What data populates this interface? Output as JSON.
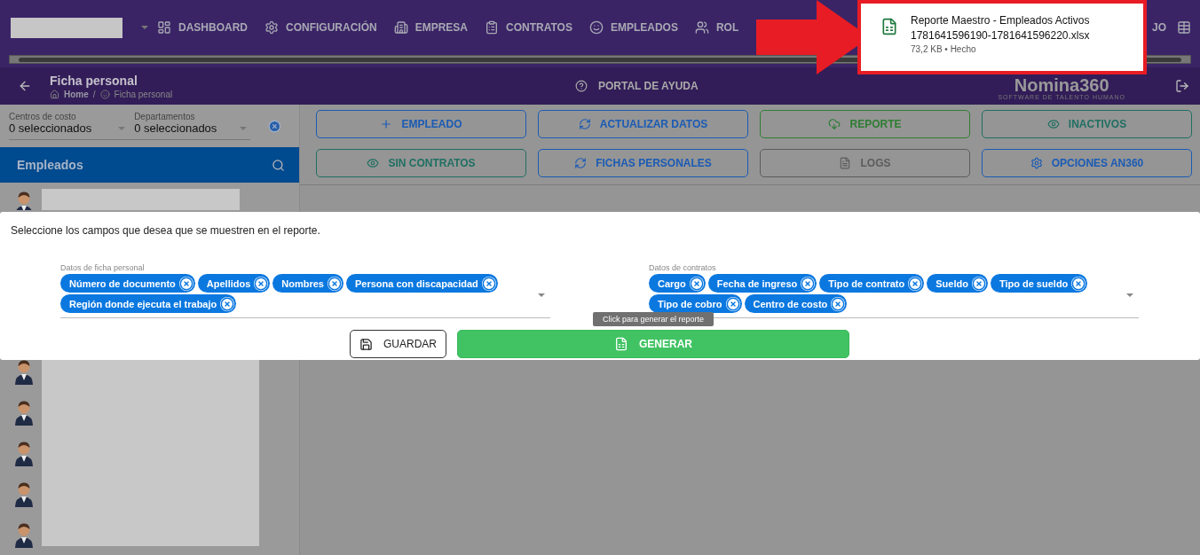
{
  "nav": {
    "items": [
      {
        "label": "DASHBOARD"
      },
      {
        "label": "CONFIGURACIÓN"
      },
      {
        "label": "EMPRESA"
      },
      {
        "label": "CONTRATOS"
      },
      {
        "label": "EMPLEADOS"
      },
      {
        "label": "ROL"
      }
    ],
    "trailing": {
      "label": "JO"
    }
  },
  "header": {
    "title": "Ficha personal",
    "breadcrumb": [
      "Home",
      "Ficha personal"
    ],
    "separator": "/",
    "help": "PORTAL DE AYUDA",
    "logo": "Nomina360",
    "tagline": "SOFTWARE DE TALENTO HUMANO"
  },
  "filters": [
    {
      "label": "Centros de costo",
      "value": "0 seleccionados"
    },
    {
      "label": "Departamentos",
      "value": "0 seleccionados"
    }
  ],
  "employees_panel": {
    "title": "Empleados"
  },
  "actions": [
    {
      "label": "EMPLEADO",
      "color": "#1a5bb5"
    },
    {
      "label": "ACTUALIZAR DATOS",
      "color": "#1a5bb5"
    },
    {
      "label": "REPORTE",
      "color": "#2e7d32"
    },
    {
      "label": "INACTIVOS",
      "color": "#1f6f62"
    },
    {
      "label": "SIN CONTRATOS",
      "color": "#1f6f62"
    },
    {
      "label": "FICHAS PERSONALES",
      "color": "#1a5bb5"
    },
    {
      "label": "LOGS",
      "color": "#5c5c5c"
    },
    {
      "label": "OPCIONES AN360",
      "color": "#1a5bb5"
    }
  ],
  "dialog": {
    "prompt": "Seleccione los campos que desea que se muestren en el reporte.",
    "selects": [
      {
        "label": "Datos de ficha personal",
        "chips": [
          "Número de documento",
          "Apellidos",
          "Nombres",
          "Persona con discapacidad",
          "Región donde ejecuta el trabajo"
        ]
      },
      {
        "label": "Datos de contratos",
        "chips": [
          "Cargo",
          "Fecha de ingreso",
          "Tipo de contrato",
          "Sueldo",
          "Tipo de sueldo",
          "Tipo de cobro",
          "Centro de costo"
        ]
      }
    ],
    "buttons": [
      {
        "label": "GUARDAR",
        "kind": "outline"
      },
      {
        "label": "GENERAR",
        "kind": "primary"
      }
    ],
    "tooltip": "Click para generar el reporte"
  },
  "download": {
    "title": "Reporte Maestro - Empleados Activos",
    "filename": "1781641596190-1781641596220.xlsx",
    "status": "73,2 KB • Hecho"
  }
}
